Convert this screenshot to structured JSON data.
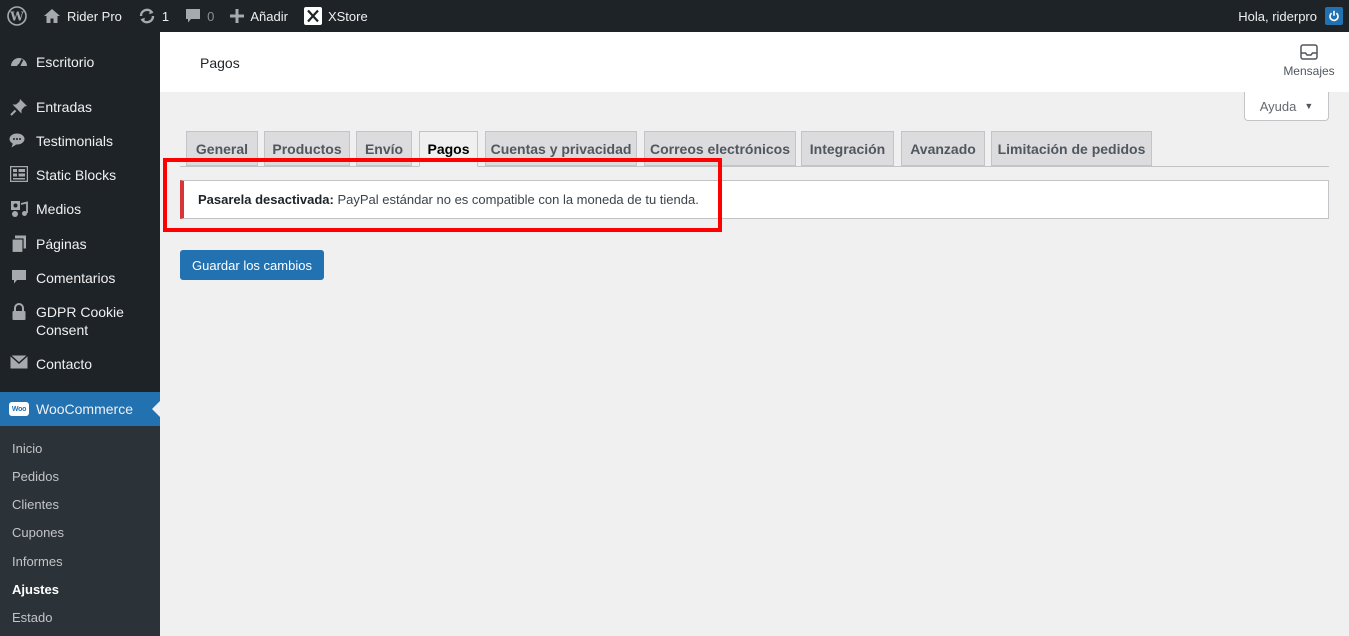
{
  "admin_bar": {
    "wp_logo_icon": "wordpress-logo-icon",
    "site_name": "Rider Pro",
    "updates_count": "1",
    "comments_count": "0",
    "new_label": "Añadir",
    "xstore_label": "XStore",
    "greeting": "Hola, riderpro"
  },
  "sidebar": {
    "items": [
      {
        "label": "Escritorio",
        "icon": "dashboard-icon"
      },
      {
        "label": "Entradas",
        "icon": "pin-icon"
      },
      {
        "label": "Testimonials",
        "icon": "speech-bubbles-icon"
      },
      {
        "label": "Static Blocks",
        "icon": "grid-icon"
      },
      {
        "label": "Medios",
        "icon": "media-icon"
      },
      {
        "label": "Páginas",
        "icon": "pages-icon"
      },
      {
        "label": "Comentarios",
        "icon": "comment-icon"
      },
      {
        "label": "GDPR Cookie",
        "label2": "Consent",
        "icon": "lock-icon"
      },
      {
        "label": "Contacto",
        "icon": "envelope-icon"
      }
    ],
    "active": {
      "label": "WooCommerce",
      "logo_text": "Woo"
    },
    "submenu": [
      "Inicio",
      "Pedidos",
      "Clientes",
      "Cupones",
      "Informes",
      "Ajustes",
      "Estado"
    ],
    "submenu_current": "Ajustes"
  },
  "header": {
    "title": "Pagos",
    "inbox_label": "Mensajes"
  },
  "help_label": "Ayuda",
  "tabs": [
    {
      "label": "General"
    },
    {
      "label": "Productos"
    },
    {
      "label": "Envío"
    },
    {
      "label": "Pagos",
      "active": true
    },
    {
      "label": "Cuentas y privacidad"
    },
    {
      "label": "Correos electrónicos"
    },
    {
      "label": "Integración"
    },
    {
      "label": "Avanzado"
    },
    {
      "label": "Limitación de pedidos"
    }
  ],
  "notice": {
    "title": "Pasarela desactivada:",
    "message": " PayPal estándar no es compatible con la moneda de tu tienda."
  },
  "save_label": "Guardar los cambios",
  "colors": {
    "admin_bar": "#1d2327",
    "accent": "#2271b1",
    "error": "#d63638",
    "highlight": "#ff0000"
  }
}
